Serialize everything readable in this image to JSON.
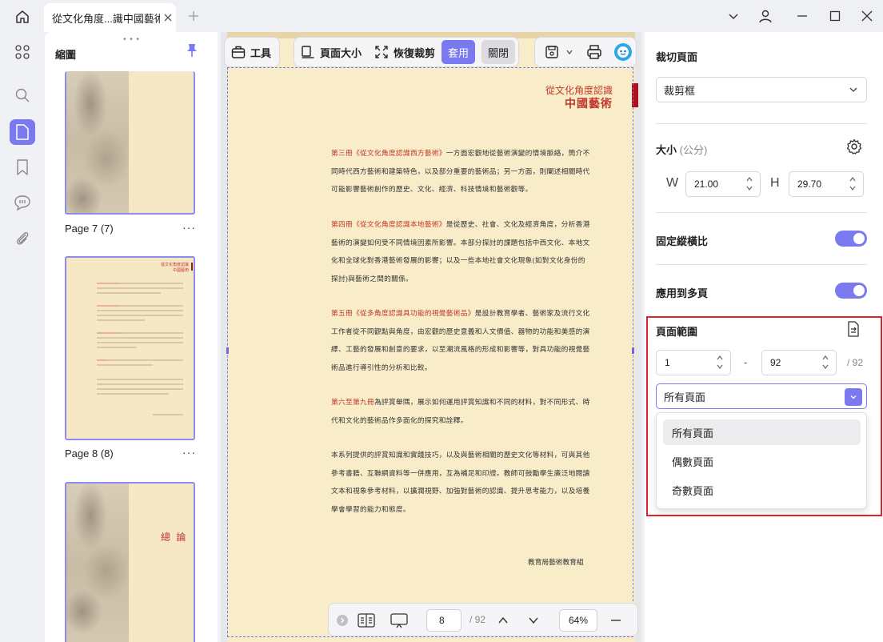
{
  "tab": {
    "title": "從文化角度...識中國藝術"
  },
  "thumbnails": {
    "title": "縮圖",
    "pages": [
      {
        "label": "Page 7 (7)"
      },
      {
        "label": "Page 8 (8)"
      },
      {
        "label": ""
      }
    ],
    "more": "···",
    "page8_header_small": "從文化角度認識",
    "page8_header_big": "中國藝術",
    "page9_title": "總 論"
  },
  "toolbar": {
    "tools": "工具",
    "page_size": "頁面大小",
    "restore_crop": "恢復裁剪",
    "apply": "套用",
    "close": "關閉"
  },
  "document": {
    "header_small": "從文化角度認識",
    "header_big": "中國藝術",
    "paragraphs": [
      {
        "hl": "第三冊《從文化角度認識西方藝術》",
        "text": "一方面宏觀地從藝術演變的情境脈絡，簡介不同時代西方藝術和建築特色，以及部分重要的藝術品；另一方面，則闡述相關時代可能影響藝術創作的歷史、文化、經濟、科技情境和藝術觀等。"
      },
      {
        "hl": "第四冊《從文化角度認識本地藝術》",
        "text": "是從歷史、社會、文化及經濟角度，分析香港藝術的演變如何受不同情境因素所影響。本部分探討的課題包括中西文化、本地文化和全球化對香港藝術發展的影響；以及一些本地社會文化現象(如對文化身份的探討)與藝術之間的關係。"
      },
      {
        "hl": "第五冊《從多角度認識具功能的視覺藝術品》",
        "text": "是設計教育學者、藝術家及流行文化工作者從不同觀點與角度，由宏觀的歷史意義和人文價值、器物的功能和美感的演繹、工藝的發展和創意的要求，以至潮流風格的形成和影響等，對具功能的視覺藝術品進行導引性的分析和比較。"
      },
      {
        "hl": "第六至第九冊",
        "text": "為評賞舉隅，展示如何運用評賞知識和不同的材料，對不同形式、時代和文化的藝術品作多面化的探究和詮釋。"
      },
      {
        "hl": "",
        "text": "本系列提供的評賞知識和實踐技巧，以及與藝術相關的歷史文化等材料，可與其他參考書籍、互聯網資料等一併應用，互為補足和印證。教師可鼓勵學生廣泛地閱讀文本和視象參考材料，以擴濶視野、加強對藝術的認識、提升思考能力，以及培養學會學習的能力和態度。"
      }
    ],
    "signature": "教育局藝術教育組"
  },
  "bottom_bar": {
    "current_page": "8",
    "total_pages": "/ 92",
    "zoom": "64%"
  },
  "right_panel": {
    "crop_title": "裁切頁面",
    "crop_box_select": "裁剪框",
    "size_title": "大小",
    "size_unit": "(公分)",
    "w_label": "W",
    "w_value": "21.00",
    "h_label": "H",
    "h_value": "29.70",
    "lock_ratio": "固定縱橫比",
    "apply_multi": "應用到多頁",
    "range_title": "頁面範圍",
    "range_from": "1",
    "range_dash": "-",
    "range_to": "92",
    "range_total": "/ 92",
    "range_select": "所有頁面",
    "options": [
      "所有頁面",
      "偶數頁面",
      "奇數頁面"
    ],
    "accent": "#7b79f0",
    "highlight_border": "#e0232a"
  }
}
